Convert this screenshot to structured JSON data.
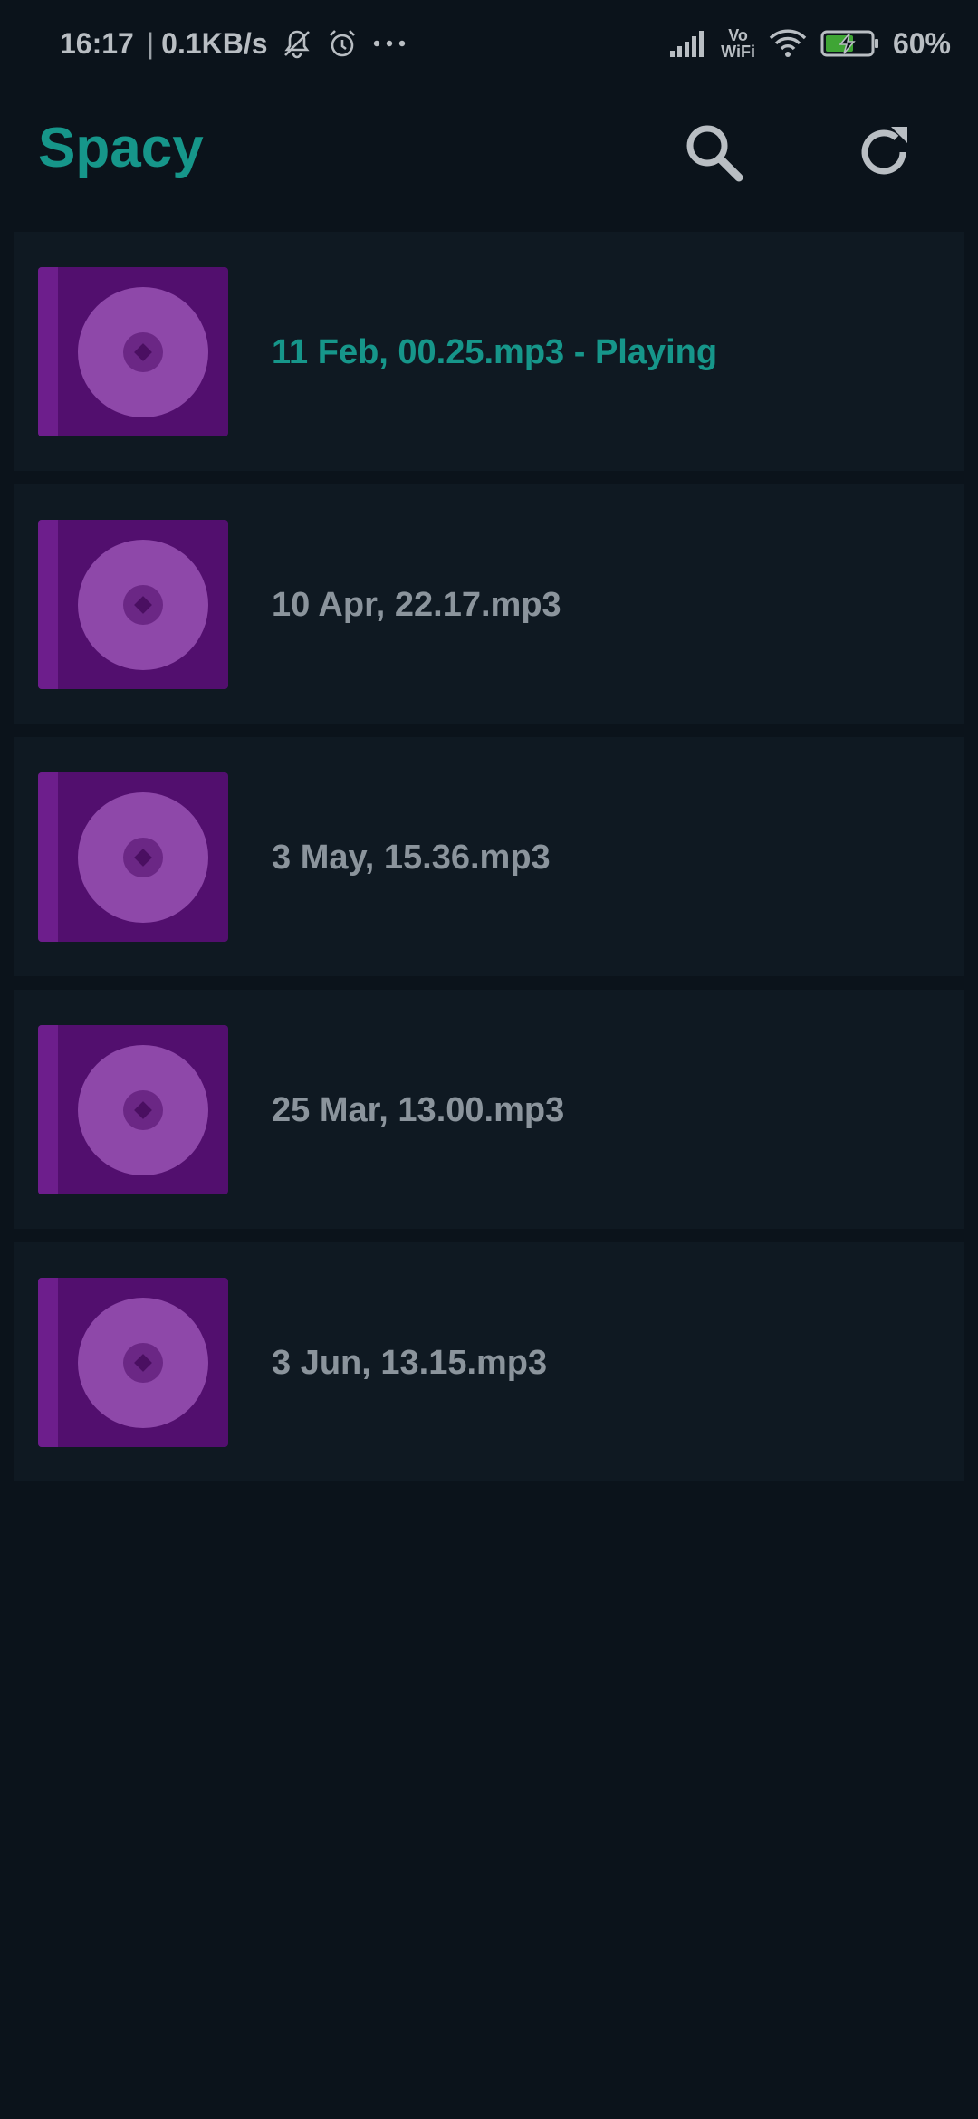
{
  "status_bar": {
    "time": "16:17",
    "separator": "|",
    "net_speed": "0.1KB/s",
    "volte_top": "Vo",
    "volte_bottom": "WiFi",
    "battery": "60%",
    "icons": [
      "mute-bell-icon",
      "alarm-icon",
      "more-dots-icon",
      "signal-icon",
      "wifi-icon",
      "battery-charging-icon"
    ]
  },
  "app_bar": {
    "title": "Spacy",
    "actions": [
      "search-icon",
      "refresh-icon"
    ]
  },
  "colors": {
    "accent": "#16968a",
    "background": "#0b131b",
    "card": "#0f1922",
    "album_art": "#520f6e",
    "text_secondary": "#8b949c"
  },
  "tracks": [
    {
      "title": "11 Feb, 00.25.mp3 - Playing",
      "playing": true
    },
    {
      "title": "10 Apr, 22.17.mp3",
      "playing": false
    },
    {
      "title": "3 May, 15.36.mp3",
      "playing": false
    },
    {
      "title": "25 Mar, 13.00.mp3",
      "playing": false
    },
    {
      "title": "3 Jun, 13.15.mp3",
      "playing": false
    }
  ]
}
